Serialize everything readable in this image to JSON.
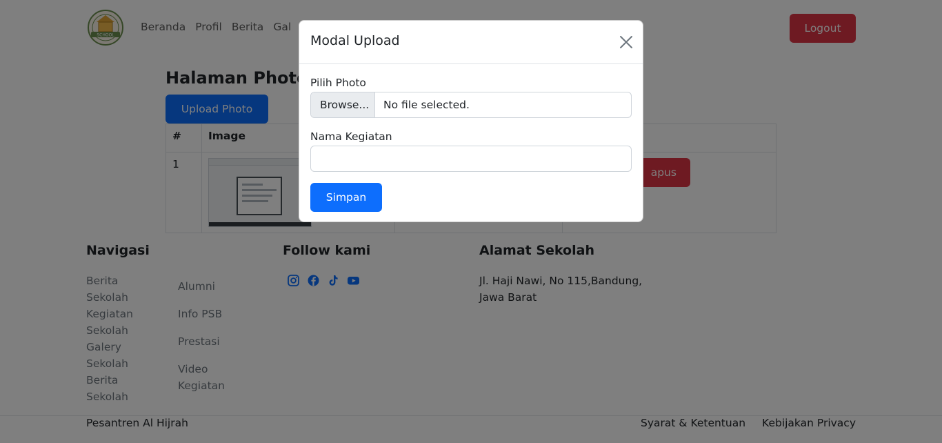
{
  "navbar": {
    "links": [
      "Beranda",
      "Profil",
      "Berita",
      "Gal"
    ],
    "logout_label": "Logout",
    "logo_text": "SCHOOL"
  },
  "main": {
    "title": "Halaman Photo",
    "upload_button": "Upload Photo",
    "table": {
      "headers": [
        "#",
        "Image"
      ],
      "rows": [
        {
          "no": "1",
          "delete_label": "apus"
        }
      ]
    }
  },
  "footer": {
    "nav_heading": "Navigasi",
    "nav_col1": [
      "Berita",
      "Sekolah",
      "Kegiatan",
      "Sekolah",
      "Galery",
      "Sekolah",
      "Berita",
      "Sekolah"
    ],
    "nav_col2": [
      "Alumni",
      "Info PSB",
      "Prestasi",
      "Video Kegiatan"
    ],
    "follow_heading": "Follow kami",
    "socials": [
      "instagram-icon",
      "facebook-icon",
      "tiktok-icon",
      "youtube-icon"
    ],
    "address_heading": "Alamat Sekolah",
    "address": "Jl. Haji Nawi, No 115,Bandung, Jawa Barat",
    "copyright": "Pesantren Al Hijrah",
    "links": [
      "Syarat & Ketentuan",
      "Kebijakan Privacy"
    ]
  },
  "modal": {
    "title": "Modal Upload",
    "photo_label": "Pilih Photo",
    "browse_label": "Browse...",
    "file_status": "No file selected.",
    "name_label": "Nama Kegiatan",
    "name_value": "",
    "submit_label": "Simpan"
  },
  "colors": {
    "primary": "#0d6efd",
    "danger": "#dc3545",
    "social": "#0d6efd"
  }
}
